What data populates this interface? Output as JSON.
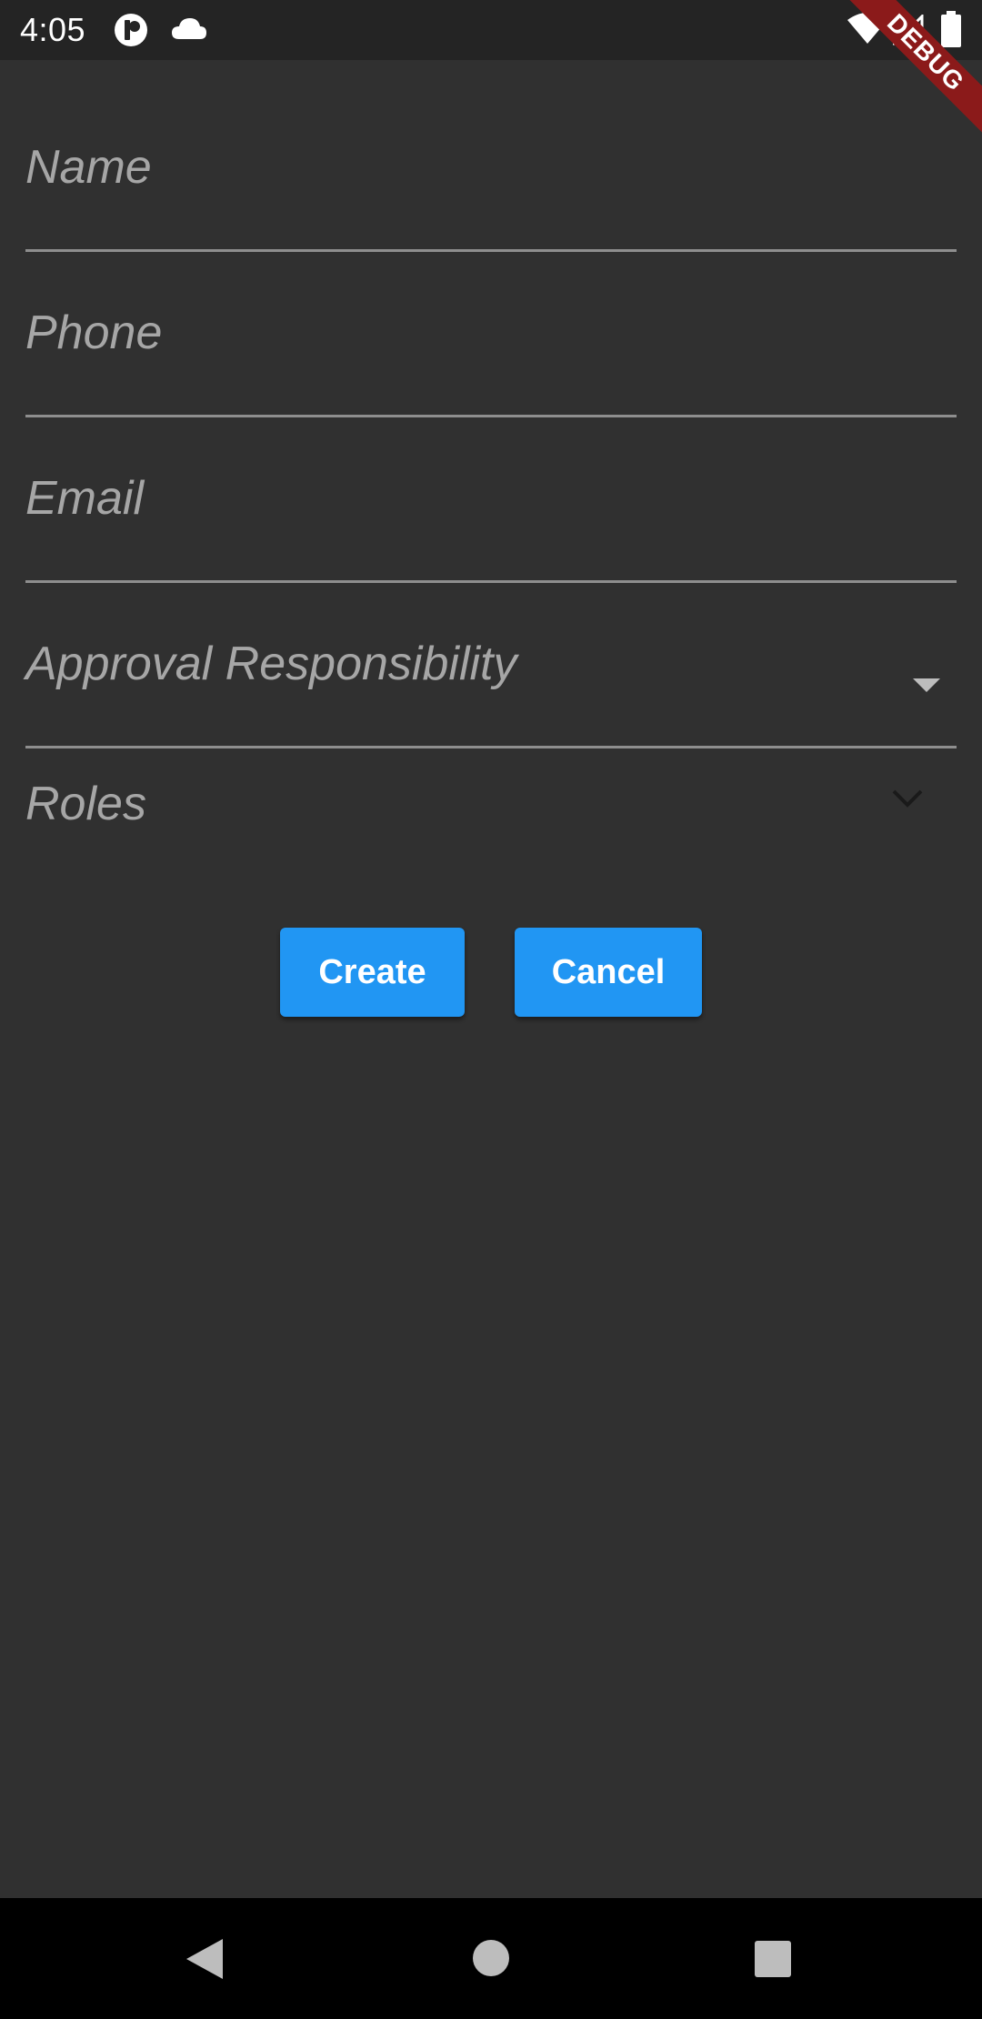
{
  "status_bar": {
    "time": "4:05",
    "left_icons": [
      "app-notification-icon",
      "cloud-icon"
    ],
    "right_icons": [
      "wifi-icon",
      "cell-signal-icon",
      "battery-icon"
    ]
  },
  "debug_banner": {
    "label": "DEBUG",
    "color": "#8b1a1a"
  },
  "form": {
    "name_field": {
      "label": "Name"
    },
    "phone_field": {
      "label": "Phone"
    },
    "email_field": {
      "label": "Email"
    },
    "approval_field": {
      "label": "Approval Responsibility",
      "icon": "dropdown-triangle-icon"
    },
    "roles_field": {
      "label": "Roles",
      "icon": "chevron-down-icon"
    }
  },
  "actions": {
    "create_label": "Create",
    "cancel_label": "Cancel",
    "accent_color": "#2196f3"
  },
  "nav_bar": {
    "buttons": [
      "back-icon",
      "home-icon",
      "recents-icon"
    ]
  },
  "colors": {
    "background": "#303030",
    "status_bar": "#242424",
    "label_text": "#a6a6a6",
    "underline": "#8e8e8e"
  }
}
